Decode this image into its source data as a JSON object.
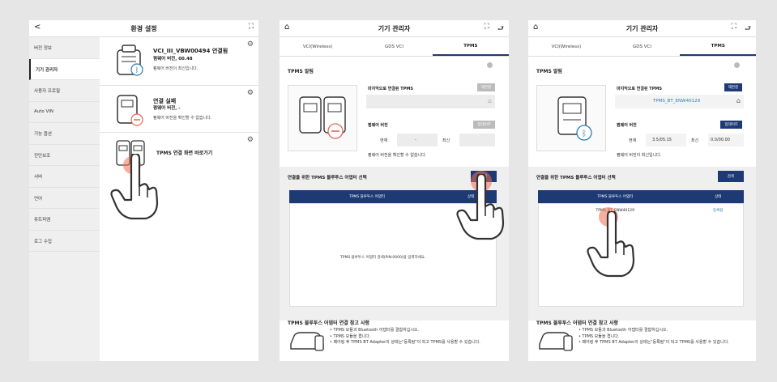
{
  "panel1": {
    "title": "환경 설정",
    "back": "<",
    "sidebar": [
      "버전 정보",
      "기기 관리자",
      "사용자 프로필",
      "Auto VIN",
      "기능 옵션",
      "진단보조",
      "서버",
      "언어",
      "퓨트피엠",
      "로그 수집"
    ],
    "vci1": {
      "title": "VCI_III_VBW00494 연결됨",
      "sub": "펌웨어 버전, 00.48",
      "msg": "펌웨어 버전이 최신입니다."
    },
    "vci2": {
      "title": "연결 실패",
      "sub": "펌웨어 버전, -",
      "msg": "펌웨어 버전을 확인할 수 없습니다."
    },
    "tpms_link": "TPMS 연결 화면 바로가기"
  },
  "panel2": {
    "title": "기기 관리자",
    "tabs": [
      "VCI(Wireless)",
      "GDS VCI",
      "TPMS"
    ],
    "section": "TPMS 알림",
    "last_label": "마지막으로 연결된 TPMS",
    "last_btn": "재연결",
    "last_value": "",
    "fw_label": "펌웨어 버전",
    "fw_btn": "업데이트",
    "current_label": "현재",
    "current_val": "-",
    "latest_label": "최신",
    "latest_val": "",
    "fw_msg": "펌웨어 버전을 확인할 수 없습니다.",
    "adapter_title": "연결을 위한 TPMS 블루투스 어댑터 선택",
    "search_btn": "검색",
    "col1": "TPMS 블루투스 어댑터",
    "col2": "상태",
    "empty_msg": "TPMS 블루투스 어댑터 검색(PIN:0000)을 입력하세요.",
    "notes_title": "TPMS 블루투스 어댑터 연결 참고 사항",
    "notes": [
      "• TPMS 모듈과 Bluetooth 어댑터를 결합하십시오.",
      "• TPMS 모듈을 켭니다.",
      "• 페어링 후 TPMS BT Adapter의 상태는\"등록됨\"이 되고 TPMS를 사용할 수 있습니다."
    ]
  },
  "panel3": {
    "title": "기기 관리자",
    "tabs": [
      "VCI(Wireless)",
      "GDS VCI",
      "TPMS"
    ],
    "section": "TPMS 알림",
    "last_label": "마지막으로 연결된 TPMS",
    "last_btn": "재연결",
    "last_value": "TPMS_BT_ENW40129",
    "fw_label": "펌웨어 버전",
    "fw_btn": "업데이트",
    "current_label": "현재",
    "current_val": "3.5/05.15",
    "latest_label": "최신",
    "latest_val": "0.0/00.00",
    "fw_msg": "펌웨어 버전이 최신입니다.",
    "adapter_title": "연결을 위한 TPMS 블루투스 어댑터 선택",
    "search_btn": "검색",
    "col1": "TPMS 블루투스 어댑터",
    "col2": "상태",
    "row_name": "TPMS_BT_ENW40129",
    "row_status": "등록됨",
    "notes_title": "TPMS 블루투스 어댑터 연결 참고 사항",
    "notes": [
      "• TPMS 모듈과 Bluetooth 어댑터를 결합하십시오.",
      "• TPMS 모듈을 켭니다.",
      "• 페어링 후 TPMS BT Adapter의 상태는\"등록됨\"이 되고 TPMS를 사용할 수 있습니다."
    ]
  },
  "colors": {
    "navy": "#1e3a74",
    "link": "#2d7fb0",
    "tap": "#f06e50"
  },
  "icons": {
    "back": "chevron-left-icon",
    "home": "home-icon",
    "expand": "expand-icon",
    "exit": "exit-icon",
    "settings": "gear-icon",
    "bluetooth": "bluetooth-icon"
  }
}
